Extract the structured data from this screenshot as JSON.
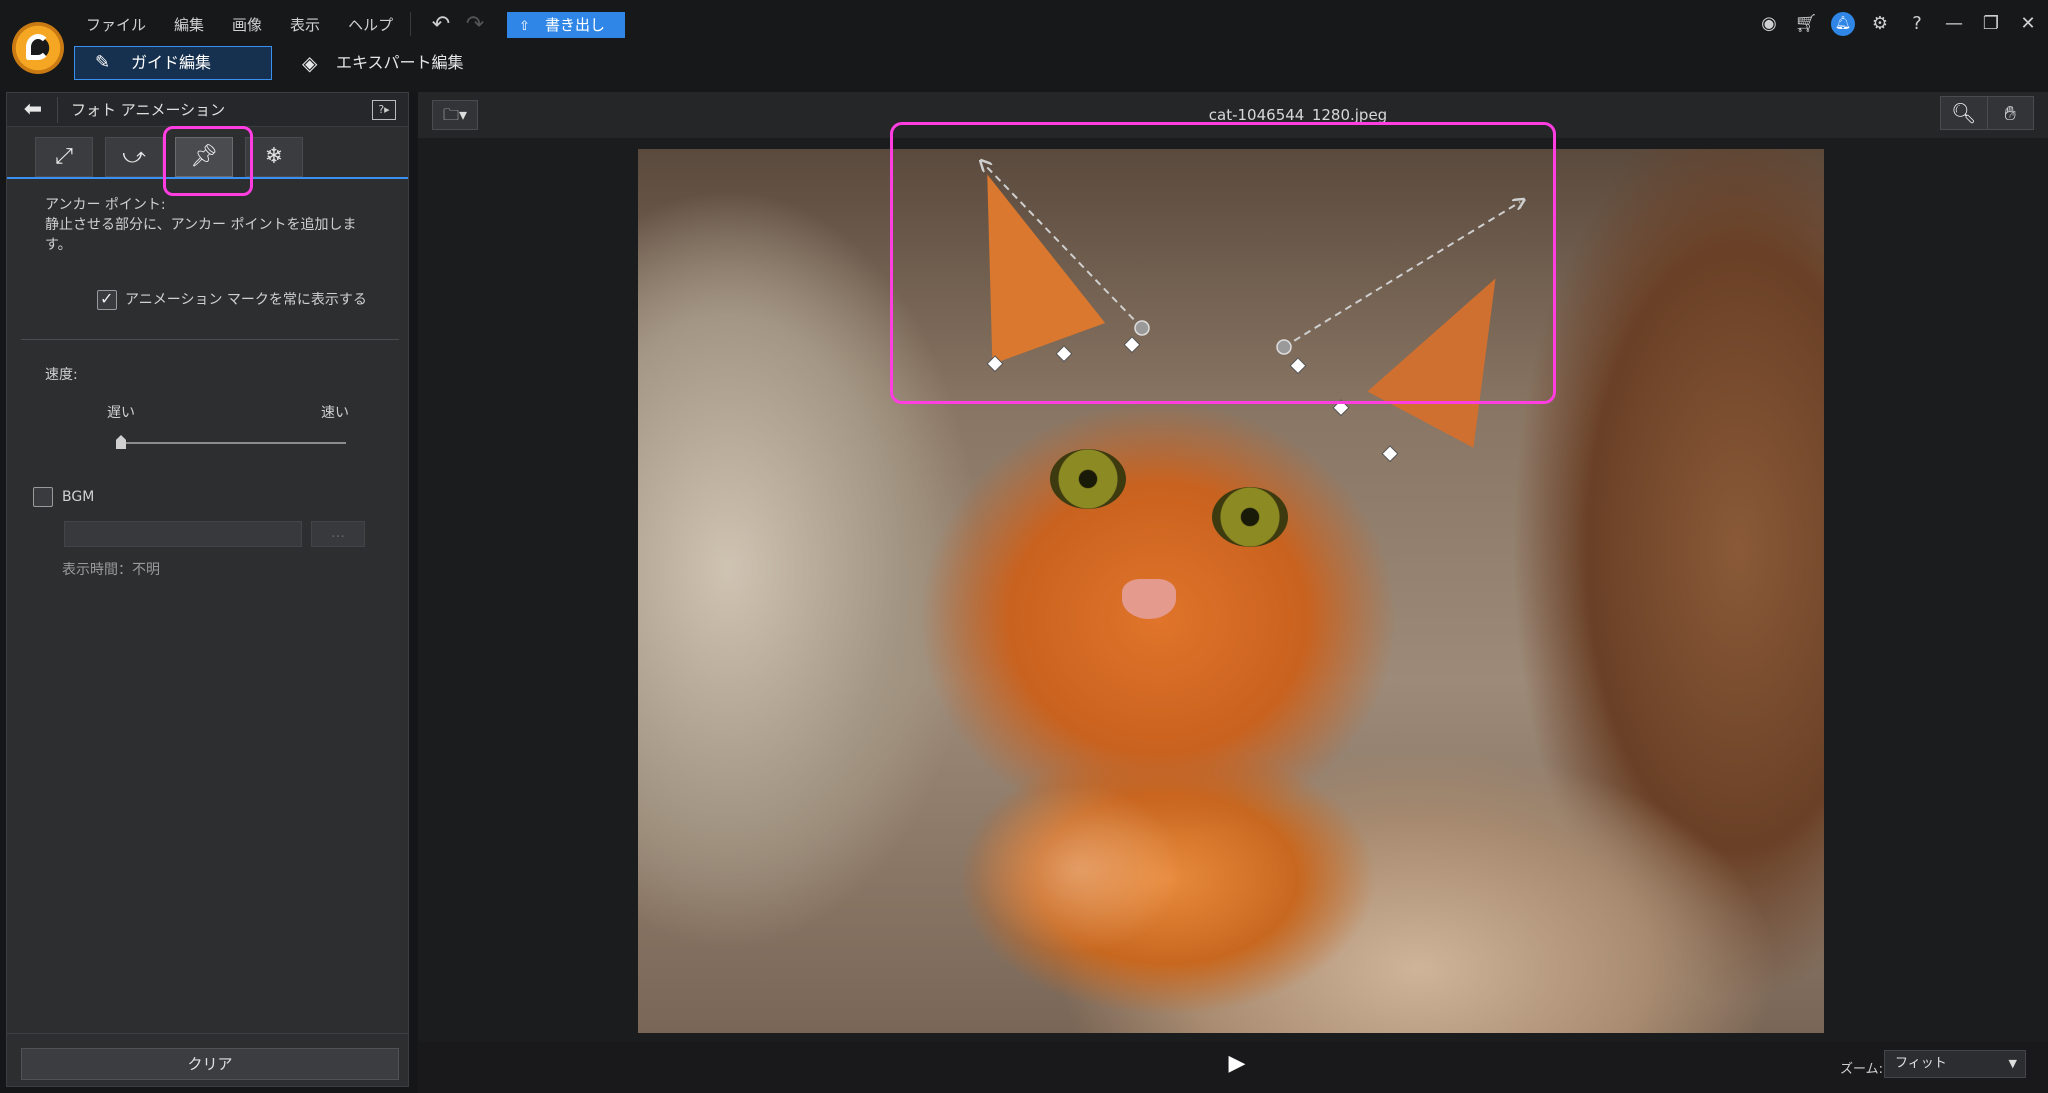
{
  "menu": {
    "items": [
      "ファイル",
      "編集",
      "画像",
      "表示",
      "ヘルプ"
    ]
  },
  "toolbar": {
    "export_label": "書き出し"
  },
  "modes": {
    "guide_label": "ガイド編集",
    "expert_label": "エキスパート編集"
  },
  "panel": {
    "title": "フォト アニメーション",
    "anchor_heading": "アンカー ポイント:",
    "anchor_desc_line1": "静止させる部分に、アンカー ポイントを追加しま",
    "anchor_desc_line2": "す。",
    "show_marks_label": "アニメーション マークを常に表示する",
    "show_marks_checked": true,
    "speed_label": "速度:",
    "speed_slow": "遅い",
    "speed_fast": "速い",
    "speed_value": 0,
    "bgm_label": "BGM",
    "bgm_checked": false,
    "bgm_browse": "…",
    "duration_text": "表示時間：不明",
    "clear_label": "クリア",
    "tabs": [
      {
        "name": "motion-arrow-tab",
        "icon": "arrow-icon",
        "active": false
      },
      {
        "name": "motion-path-tab",
        "icon": "dashed-path-icon",
        "active": false
      },
      {
        "name": "anchor-point-tab",
        "icon": "pin-icon",
        "active": true
      },
      {
        "name": "freeze-tab",
        "icon": "snowflake-icon",
        "active": false
      }
    ]
  },
  "canvas": {
    "filename": "cat-1046544_1280.jpeg",
    "zoom_label": "ズーム:",
    "zoom_value": "フィット"
  },
  "colors": {
    "accent": "#2f86e6",
    "highlight": "#ff3de0",
    "background": "#151617",
    "panel": "#2d2e30"
  }
}
